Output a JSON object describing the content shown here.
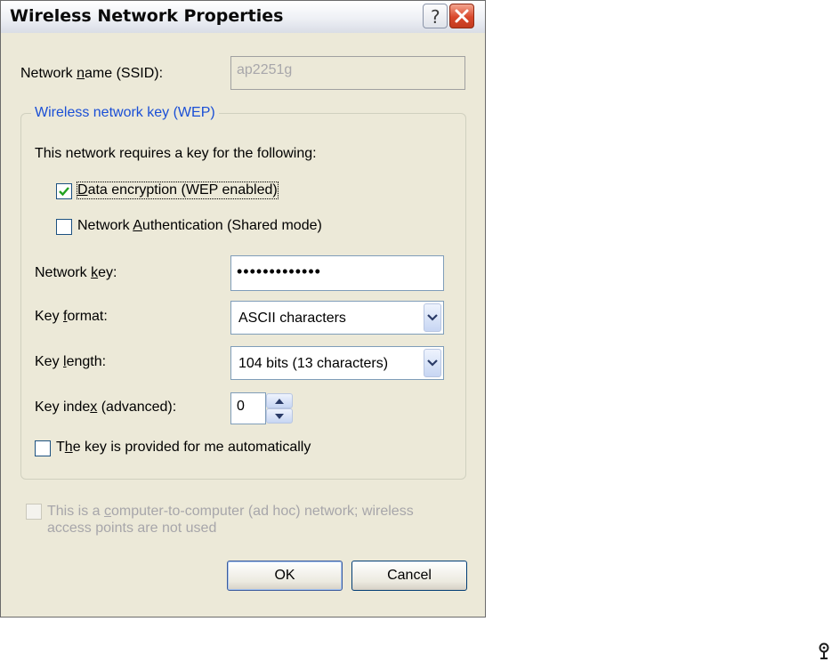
{
  "window": {
    "title": "Wireless Network Properties",
    "help_glyph": "?",
    "help_icon": "help-icon",
    "close_icon": "close-icon"
  },
  "network_name": {
    "label_pre": "Network ",
    "label_mnemonic": "n",
    "label_post": "ame (SSID):",
    "value": "ap2251g"
  },
  "wep_group": {
    "legend": "Wireless network key (WEP)",
    "intro": "This network requires a key for the following:",
    "data_encryption": {
      "label_mnemonic": "D",
      "label_post": "ata encryption (WEP enabled)",
      "checked": true
    },
    "network_auth": {
      "label_pre": "Network ",
      "label_mnemonic": "A",
      "label_post": "uthentication (Shared mode)",
      "checked": false
    },
    "network_key": {
      "label_pre": "Network ",
      "label_mnemonic": "k",
      "label_post": "ey:",
      "value": "•••••••••••••"
    },
    "key_format": {
      "label_pre": "Key ",
      "label_mnemonic": "f",
      "label_post": "ormat:",
      "selected": "ASCII characters"
    },
    "key_length": {
      "label_pre": "Key ",
      "label_mnemonic": "l",
      "label_post": "ength:",
      "selected": "104 bits (13 characters)"
    },
    "key_index": {
      "label_pre": "Key inde",
      "label_mnemonic": "x",
      "label_post": " (advanced):",
      "value": "0"
    },
    "auto_key": {
      "label_pre": "T",
      "label_mnemonic": "h",
      "label_post": "e key is provided for me automatically",
      "checked": false
    }
  },
  "adhoc": {
    "line1_pre": "This is a ",
    "line1_mnemonic": "c",
    "line1_post": "omputer-to-computer (ad hoc) network; wireless",
    "line2": "access points are not used",
    "checked": false,
    "enabled": false
  },
  "buttons": {
    "ok": "OK",
    "cancel": "Cancel"
  },
  "colors": {
    "dialog_bg": "#ece9d8",
    "group_legend": "#1a4fd6",
    "disabled_text": "#a7a6aa",
    "checkmark": "#21a121"
  },
  "tray_icon": "pin-icon"
}
